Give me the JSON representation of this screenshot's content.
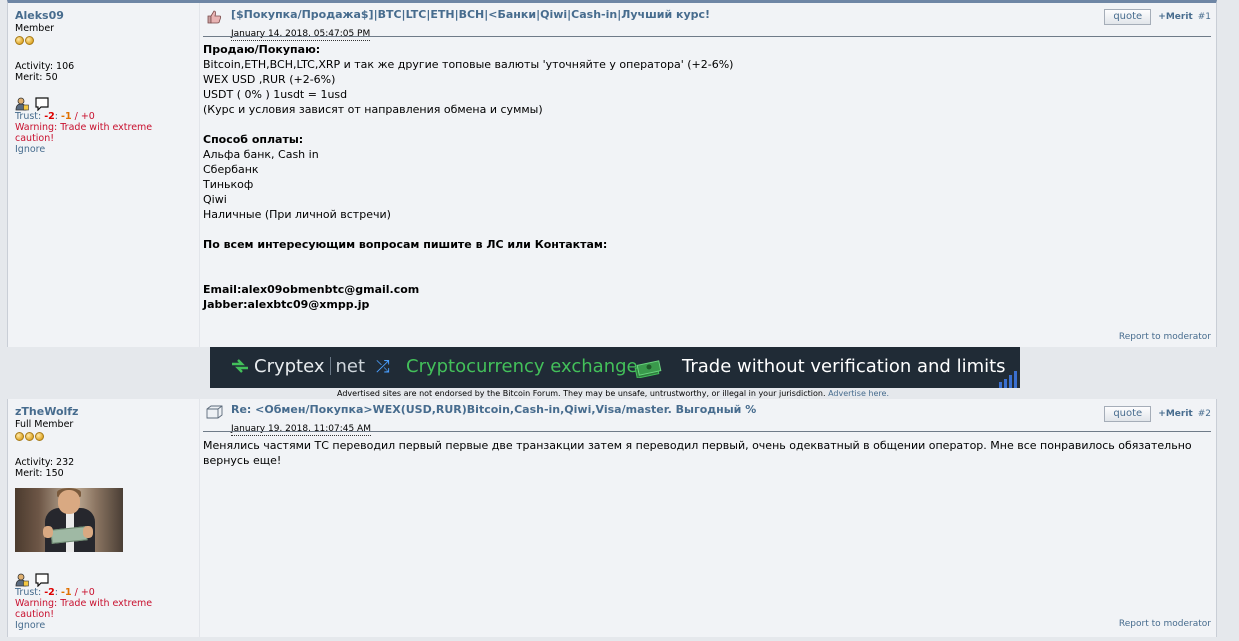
{
  "posts": [
    {
      "username": "Aleks09",
      "rank": "Member",
      "activity": "Activity: 106",
      "merit": "Merit: 50",
      "trust_label": "Trust: ",
      "trust_neg": "-2",
      "trust_sep1": ": ",
      "trust_mid": "-1",
      "trust_rest": " / +0",
      "warning": "Warning: Trade with extreme caution!",
      "ignore": "Ignore",
      "subject": "[$Покупка/Продажа$]|BTC|LTC|ETH|BCH|<Банки|Qiwi|Cash-in|Лучший курс!",
      "date": "January 14, 2018, 05:47:05 PM",
      "quote": "quote",
      "merit_btn": "+Merit",
      "number": "#1",
      "report": "Report to moderator",
      "body": [
        {
          "text": "Продаю/Покупаю:",
          "bold": true
        },
        {
          "text": "Bitcoin,ETH,BCH,LTC,XRP и так же другие топовые валюты 'уточняйте у оператора'  (+2-6%)",
          "bold": false
        },
        {
          "text": "WEX USD ,RUR (+2-6%)",
          "bold": false
        },
        {
          "text": "USDT ( 0% ) 1usdt = 1usd",
          "bold": false
        },
        {
          "text": "(Курс и условия зависят от направления обмена и суммы)",
          "bold": false
        },
        {
          "text": "",
          "bold": false
        },
        {
          "text": "Способ оплаты:",
          "bold": true
        },
        {
          "text": "Альфа банк, Cash in",
          "bold": false
        },
        {
          "text": "Сбербанк",
          "bold": false
        },
        {
          "text": "Тинькоф",
          "bold": false
        },
        {
          "text": "Qiwi",
          "bold": false
        },
        {
          "text": "Наличные (При личной встречи)",
          "bold": false
        },
        {
          "text": "",
          "bold": false
        },
        {
          "text": "По всем интересующим вопросам пишите в ЛС или Контактам:",
          "bold": true
        },
        {
          "text": "",
          "bold": false
        },
        {
          "text": "",
          "bold": false
        },
        {
          "text": "Email:alex09obmenbtc@gmail.com",
          "bold": true
        },
        {
          "text": "Jabber:alexbtc09@xmpp.jp",
          "bold": true
        }
      ]
    },
    {
      "username": "zTheWolfz",
      "rank": "Full Member",
      "activity": "Activity: 232",
      "merit": "Merit: 150",
      "trust_label": "Trust: ",
      "trust_neg": "-2",
      "trust_sep1": ": ",
      "trust_mid": "-1",
      "trust_rest": " / +0",
      "warning": "Warning: Trade with extreme caution!",
      "ignore": "Ignore",
      "subject": "Re: <Обмен/Покупка>WEX(USD,RUR)Bitcoin,Cash-in,Qiwi,Visa/master. Выгодный %",
      "date": "January 19, 2018, 11:07:45 AM",
      "quote": "quote",
      "merit_btn": "+Merit",
      "number": "#2",
      "report": "Report to moderator",
      "body": [
        {
          "text": "Менялись частями ТС переводил первый первые две транзакции затем я переводил первый, очень одекватный в общении оператор. Мне все понравилось обязательно вернусь еще!",
          "bold": false
        }
      ]
    }
  ],
  "ad": {
    "brand": "Cryptex",
    "brand_suffix": "net",
    "tagline": "Cryptocurrency exchange",
    "slogan": "Trade without verification and limits",
    "disclaimer": "Advertised sites are not endorsed by the Bitcoin Forum. They may be unsafe, untrustworthy, or illegal in your jurisdiction.",
    "advertise_link": "Advertise here."
  },
  "colors": {
    "link": "#476c8e",
    "trust_negative": "#dd0000",
    "warning": "#c8102e",
    "ad_bg": "#202b36",
    "ad_green": "#43c05a"
  }
}
